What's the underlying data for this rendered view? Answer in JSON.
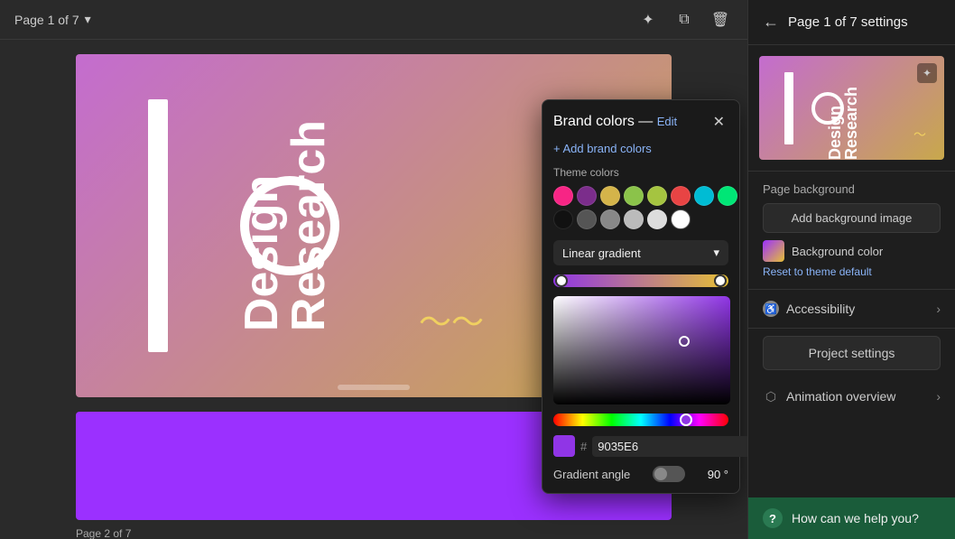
{
  "topBar": {
    "pageIndicator": "Page 1 of 7",
    "dropdownArrow": "▾"
  },
  "toolbar": {
    "magicIcon": "✦",
    "copyIcon": "⧉",
    "trashIcon": "🗑"
  },
  "slideLabel2": "Page 2 of 7",
  "colorPicker": {
    "brandColorsLabel": "Brand colors —",
    "editLabel": "Edit",
    "addBrandColors": "+ Add brand colors",
    "themeColorsLabel": "Theme colors",
    "swatches": [
      {
        "color": "#f72585"
      },
      {
        "color": "#7b2d8b"
      },
      {
        "color": "#d4b44a"
      },
      {
        "color": "#8bc34a"
      },
      {
        "color": "#a5c440"
      },
      {
        "color": "#e84444"
      },
      {
        "color": "#00bcd4"
      },
      {
        "color": "#222222"
      },
      {
        "color": "#555555"
      },
      {
        "color": "#888888"
      },
      {
        "color": "#bbbbbb"
      },
      {
        "color": "#eeeeee"
      },
      {
        "color": "#ffffff"
      },
      {
        "color": "#00e676"
      }
    ],
    "gradientType": "Linear gradient",
    "hexSymbol": "#",
    "hexValue": "9035E6",
    "gradientAngleLabel": "Gradient angle",
    "gradientAngleValue": "90 °"
  },
  "rightPanel": {
    "backArrow": "←",
    "title": "Page 1 of 7 settings",
    "magicLabel": "✦",
    "pageBackground": "Page background",
    "addBackgroundImage": "Add background image",
    "backgroundColorLabel": "Background color",
    "resetLabel": "Reset to theme default",
    "accessibilityLabel": "Accessibility",
    "accessibilityChevron": "›",
    "projectSettingsLabel": "Project settings",
    "animationOverviewLabel": "Animation overview",
    "animationChevron": "›",
    "helpText": "How can we help you?"
  }
}
